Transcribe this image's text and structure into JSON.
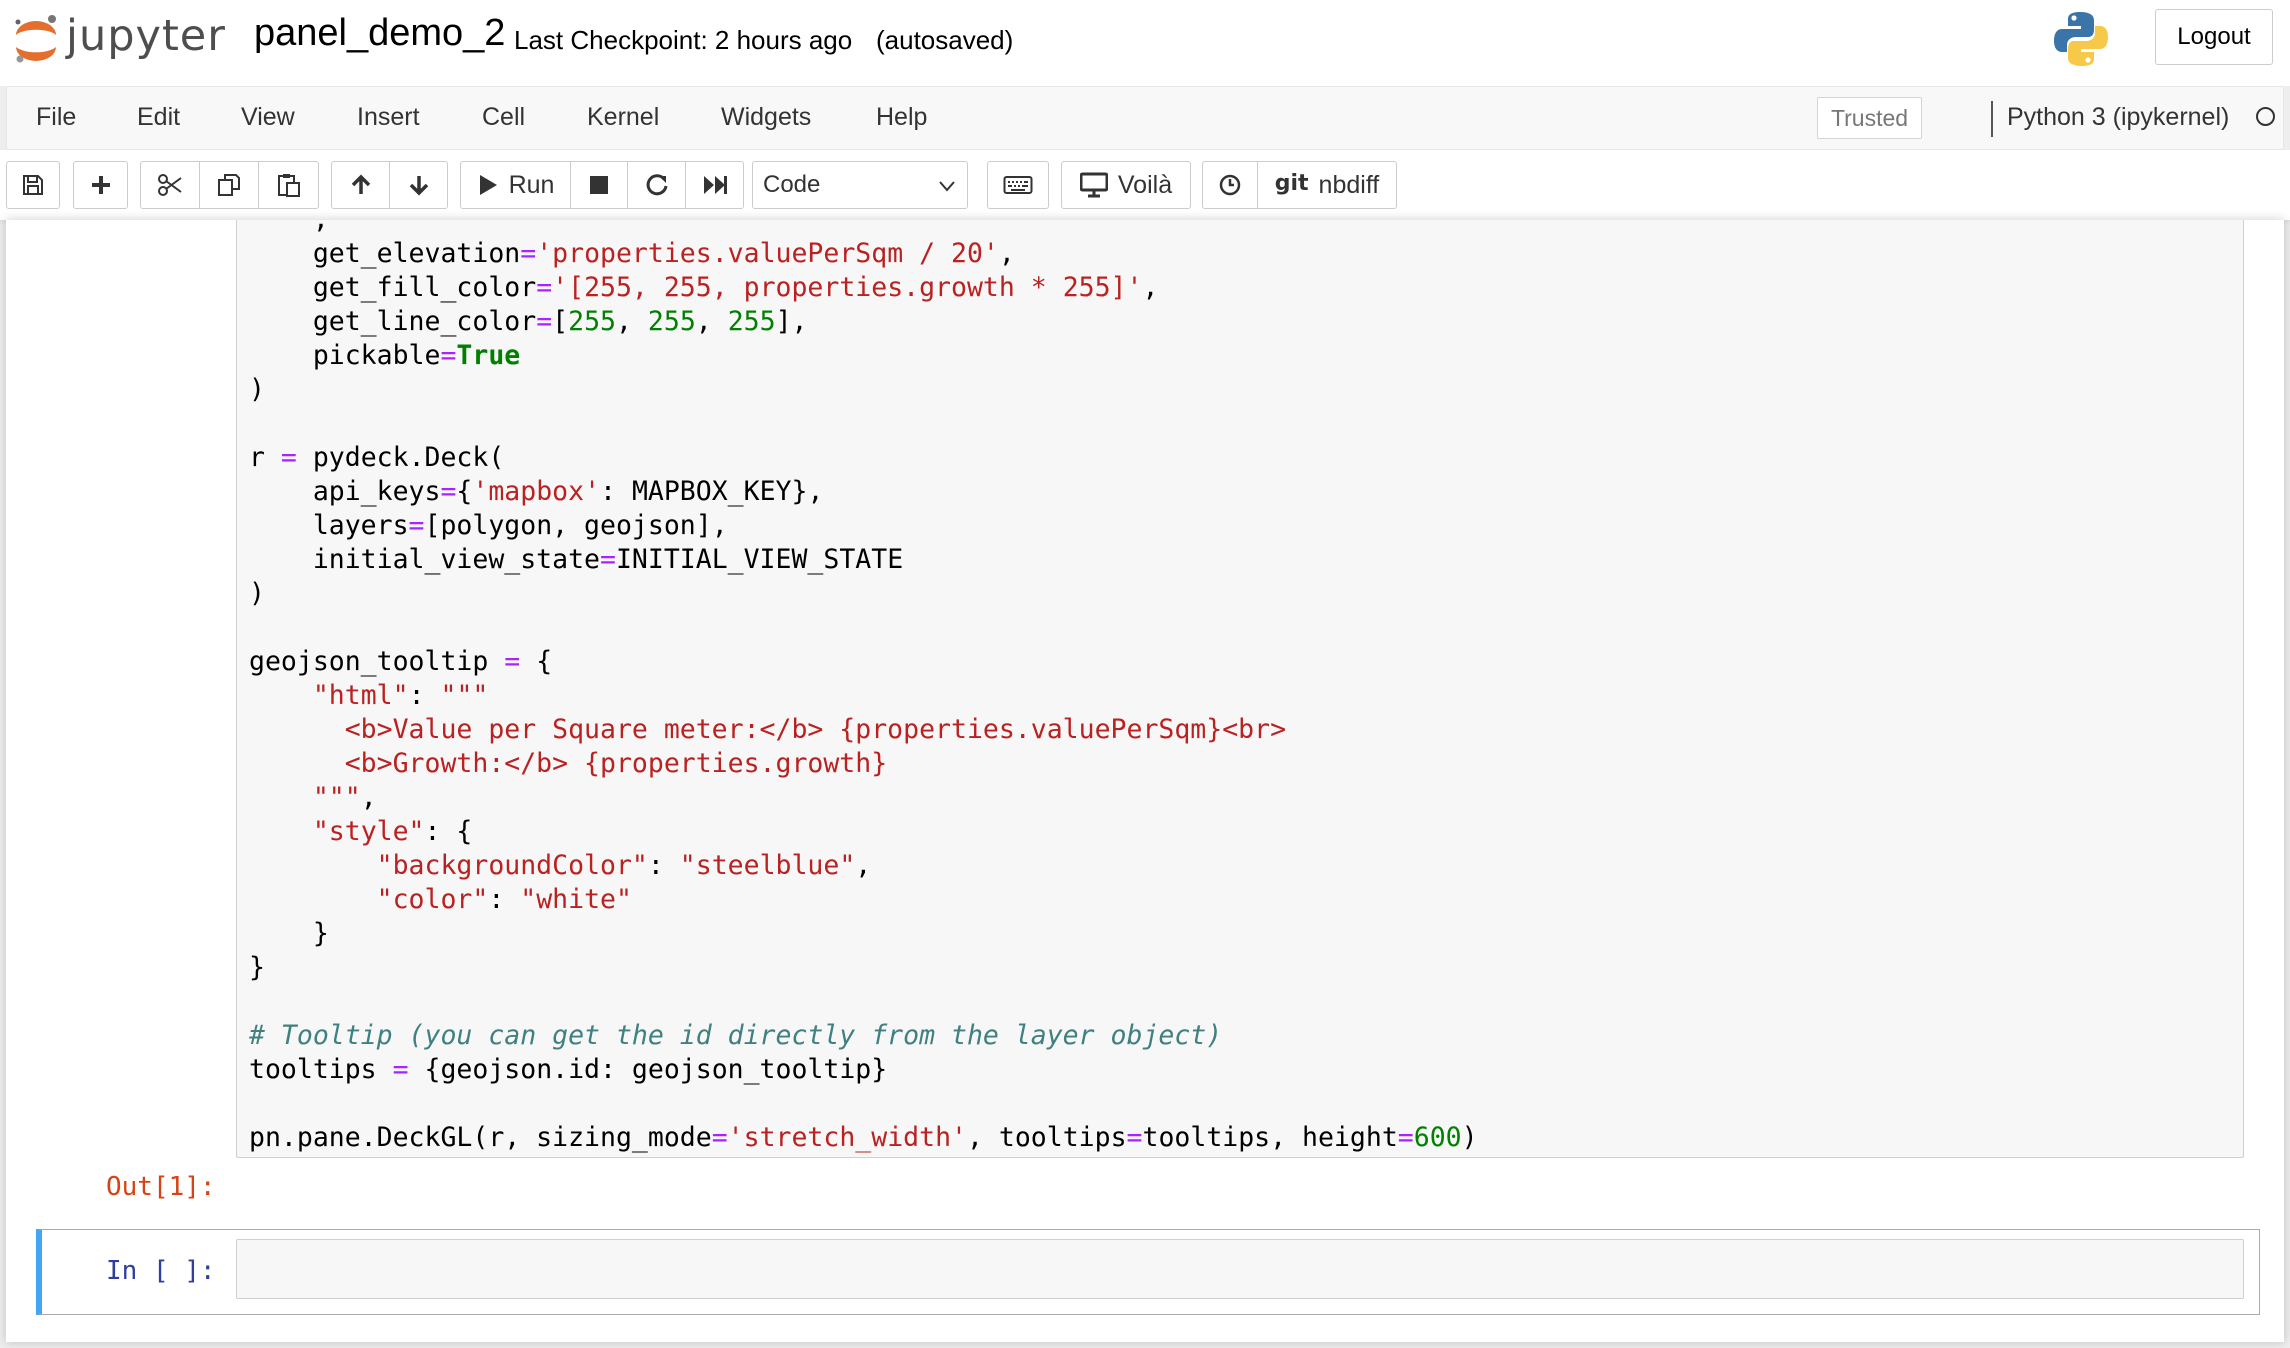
{
  "header": {
    "logo_text": "jupyter",
    "notebook_name": "panel_demo_2",
    "checkpoint": "Last Checkpoint: 2 hours ago",
    "autosave": "(autosaved)",
    "logout_label": "Logout"
  },
  "menubar": {
    "items": [
      "File",
      "Edit",
      "View",
      "Insert",
      "Cell",
      "Kernel",
      "Widgets",
      "Help"
    ],
    "trusted_label": "Trusted",
    "kernel_name": "Python 3 (ipykernel)"
  },
  "toolbar": {
    "run_label": "Run",
    "cell_type": "Code",
    "voila_label": "Voilà",
    "nbdiff_git": "git",
    "nbdiff_label": "nbdiff"
  },
  "code_lines": [
    "    get_elevation='properties.valuePerSqm / 20',",
    "    get_fill_color='[255, 255, properties.growth * 255]',",
    "    get_line_color=[255, 255, 255],",
    "    pickable=True",
    ")",
    "",
    "r = pydeck.Deck(",
    "    api_keys={'mapbox': MAPBOX_KEY},",
    "    layers=[polygon, geojson],",
    "    initial_view_state=INITIAL_VIEW_STATE",
    ")",
    "",
    "geojson_tooltip = {",
    "    \"html\": \"\"\"",
    "      <b>Value per Square meter:</b> {properties.valuePerSqm}<br>",
    "      <b>Growth:</b> {properties.growth}",
    "    \"\"\",",
    "    \"style\": {",
    "        \"backgroundColor\": \"steelblue\",",
    "        \"color\": \"white\"",
    "    }",
    "}",
    "",
    "# Tooltip (you can get the id directly from the layer object)",
    "tooltips = {geojson.id: geojson_tooltip}",
    "",
    "pn.pane.DeckGL(r, sizing_mode='stretch_width', tooltips=tooltips, height=600)"
  ],
  "out_prompt": "Out[1]:",
  "in_prompt": "In [ ]:",
  "colors": {
    "accent_blue": "#42a5f5",
    "out_prompt": "#d84315",
    "in_prompt": "#303f9f",
    "string": "#ba2121",
    "number": "#008000",
    "operator": "#aa22ff",
    "comment": "#408080"
  },
  "icons": [
    "jupyter-logo-icon",
    "python-logo-icon",
    "save-icon",
    "plus-icon",
    "scissors-icon",
    "copy-icon",
    "paste-icon",
    "arrow-up-icon",
    "arrow-down-icon",
    "play-icon",
    "stop-icon",
    "restart-icon",
    "fast-forward-icon",
    "chevron-down-icon",
    "keyboard-icon",
    "monitor-icon",
    "clock-icon"
  ]
}
